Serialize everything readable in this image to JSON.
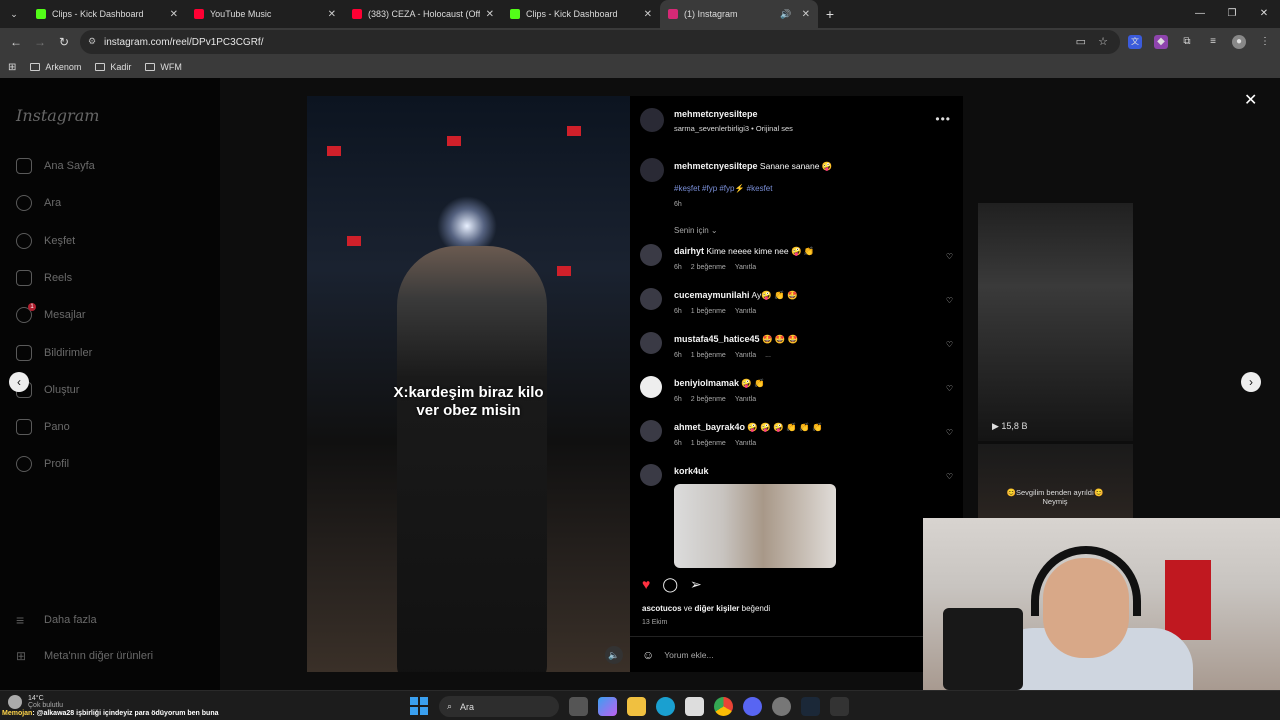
{
  "browser": {
    "tabs": [
      {
        "title": "Clips - Kick Dashboard",
        "color": "#53fc18",
        "active": false
      },
      {
        "title": "YouTube Music",
        "color": "#ff0033",
        "active": false
      },
      {
        "title": "(383) CEZA - Holocaust (Officia",
        "color": "#ff0033",
        "active": false
      },
      {
        "title": "Clips - Kick Dashboard",
        "color": "#53fc18",
        "active": false
      },
      {
        "title": "(1) Instagram",
        "color": "#d62976",
        "active": true
      }
    ],
    "url": "instagram.com/reel/DPv1PC3CGRf/",
    "bookmarks": [
      "Arkenom",
      "Kadir",
      "WFM"
    ]
  },
  "sidebar": {
    "logo": "Instagram",
    "items": [
      {
        "label": "Ana Sayfa",
        "icon": "home-icon"
      },
      {
        "label": "Ara",
        "icon": "search-icon"
      },
      {
        "label": "Keşfet",
        "icon": "compass-icon"
      },
      {
        "label": "Reels",
        "icon": "reels-icon"
      },
      {
        "label": "Mesajlar",
        "icon": "messenger-icon",
        "badge": "1"
      },
      {
        "label": "Bildirimler",
        "icon": "heart-icon"
      },
      {
        "label": "Oluştur",
        "icon": "plus-icon"
      },
      {
        "label": "Pano",
        "icon": "chart-icon"
      },
      {
        "label": "Profil",
        "icon": "profile-icon"
      }
    ],
    "more": "Daha fazla",
    "meta": "Meta'nın diğer ürünleri"
  },
  "reel": {
    "caption_line1": "X:kardeşim biraz kilo",
    "caption_line2": "ver obez misin"
  },
  "post": {
    "author": "mehmetcnyesiltepe",
    "audio": "sarma_sevenlerbirligi3 • Orijinal ses",
    "caption_user": "mehmetcnyesiltepe",
    "caption_text": "Sanane sanane 🤪",
    "hashtags": "#keşfet #fyp #fyp⚡️ #kesfet",
    "caption_time": "6h",
    "sort_label": "Senin için",
    "comments": [
      {
        "user": "dairhyt",
        "text": "Kime neeee kime nee 🤪 👏",
        "time": "6h",
        "likes": "2 beğenme",
        "reply": "Yanıtla"
      },
      {
        "user": "cucemaymunilahi",
        "text": "Ay🤪 👏 🤩",
        "time": "6h",
        "likes": "1 beğenme",
        "reply": "Yanıtla"
      },
      {
        "user": "mustafa45_hatice45",
        "text": "🤩 🤩 🤩",
        "time": "6h",
        "likes": "1 beğenme",
        "reply": "Yanıtla",
        "more": "..."
      },
      {
        "user": "beniyiolmamak",
        "text": "🤪 👏",
        "time": "6h",
        "likes": "2 beğenme",
        "reply": "Yanıtla"
      },
      {
        "user": "ahmet_bayrak4o",
        "text": "🤪 🤪 🤪 👏 👏 👏",
        "time": "6h",
        "likes": "1 beğenme",
        "reply": "Yanıtla"
      },
      {
        "user": "kork4uk",
        "text": "",
        "time": "",
        "likes": "",
        "reply": ""
      }
    ],
    "liked_by_user": "ascotucos",
    "liked_by_mid": " ve ",
    "liked_by_others": "diğer kişiler",
    "liked_by_end": " beğendi",
    "date": "13 Ekim",
    "add_comment": "Yorum ekle..."
  },
  "side_videos": {
    "views": "15,8 B",
    "caption": "😊Sevgilim benden ayrıldı😊 Neymiş"
  },
  "taskbar": {
    "temp": "14°C",
    "weather": "Çok bulutlu",
    "ticker_user": "Memojan",
    "ticker_text": ": @alkawa28 işbirliği içindeyiz para ödüyorum ben buna",
    "search": "Ara"
  }
}
